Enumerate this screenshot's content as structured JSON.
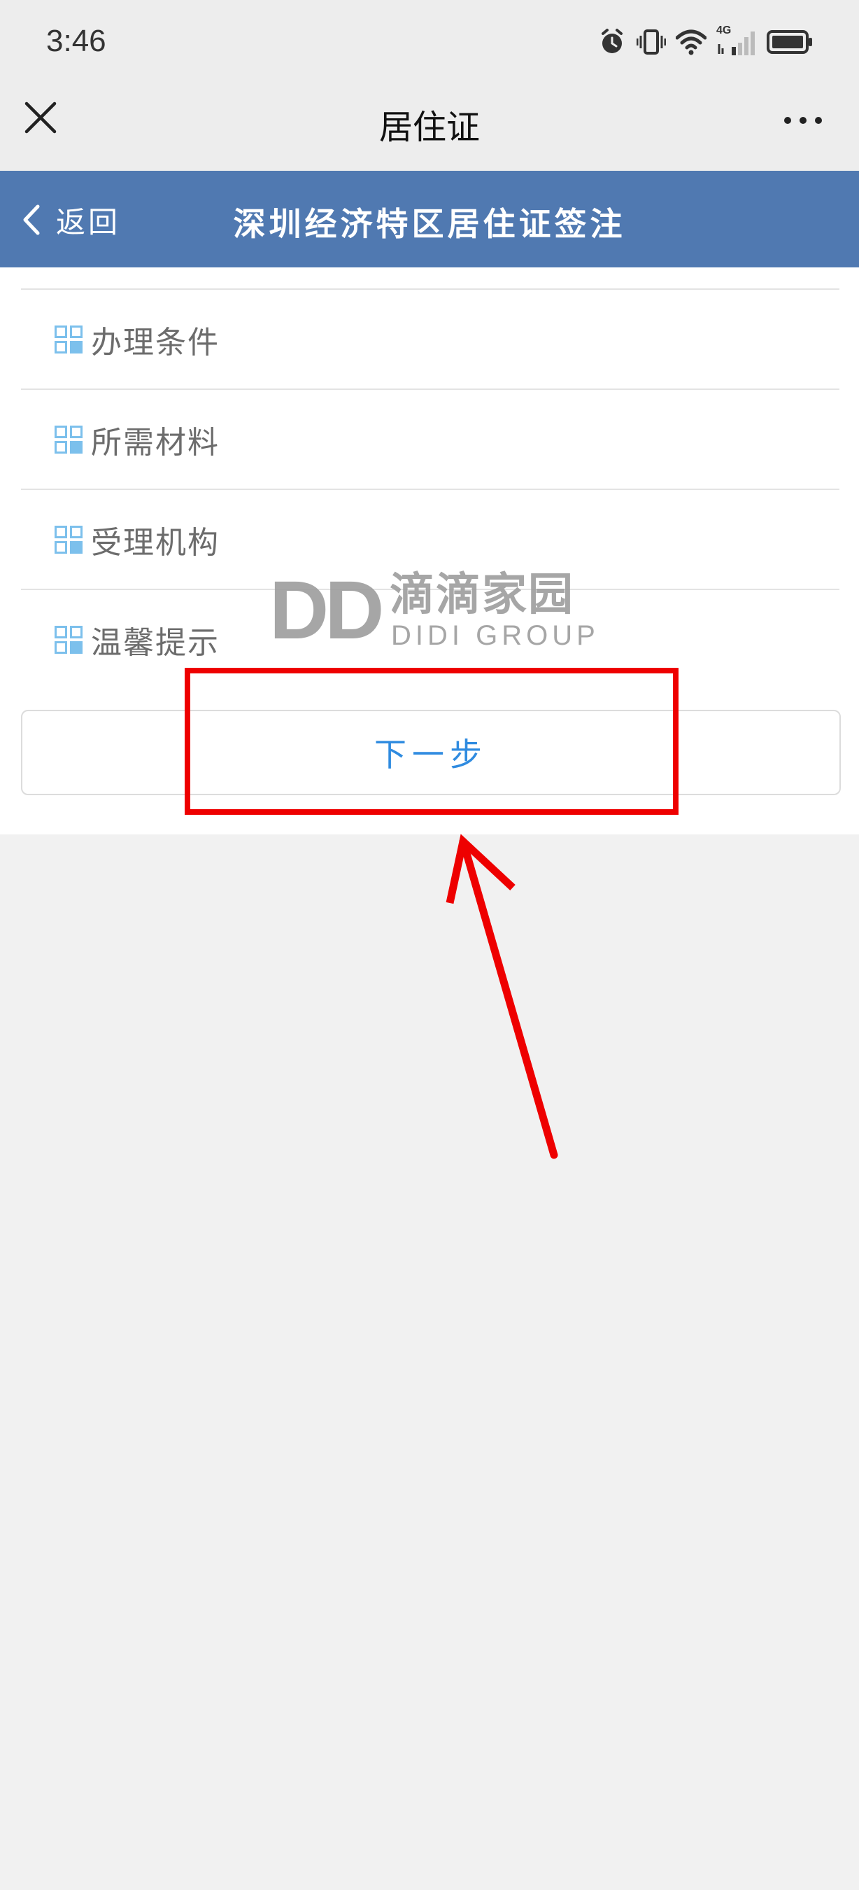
{
  "status_bar": {
    "time": "3:46",
    "network_label": "4G",
    "icons": [
      "alarm-icon",
      "vibrate-icon",
      "wifi-icon",
      "cellular-signal-icon",
      "battery-icon"
    ]
  },
  "title_bar": {
    "title": "居住证",
    "close_icon": "close-icon",
    "more_icon": "more-dots-icon"
  },
  "header": {
    "back_label": "返回",
    "title": "深圳经济特区居住证签注",
    "background_color": "#5079b1"
  },
  "menu": {
    "items": [
      {
        "label": "办理条件",
        "icon": "grid-icon"
      },
      {
        "label": "所需材料",
        "icon": "grid-icon"
      },
      {
        "label": "受理机构",
        "icon": "grid-icon"
      },
      {
        "label": "温馨提示",
        "icon": "grid-icon"
      }
    ]
  },
  "next_button": {
    "label": "下一步",
    "text_color": "#2f8be0"
  },
  "watermark": {
    "logo_text": "DD",
    "chinese_text": "滴滴家园",
    "english_text": "DIDI GROUP"
  },
  "annotation": {
    "color": "#ee0000"
  }
}
